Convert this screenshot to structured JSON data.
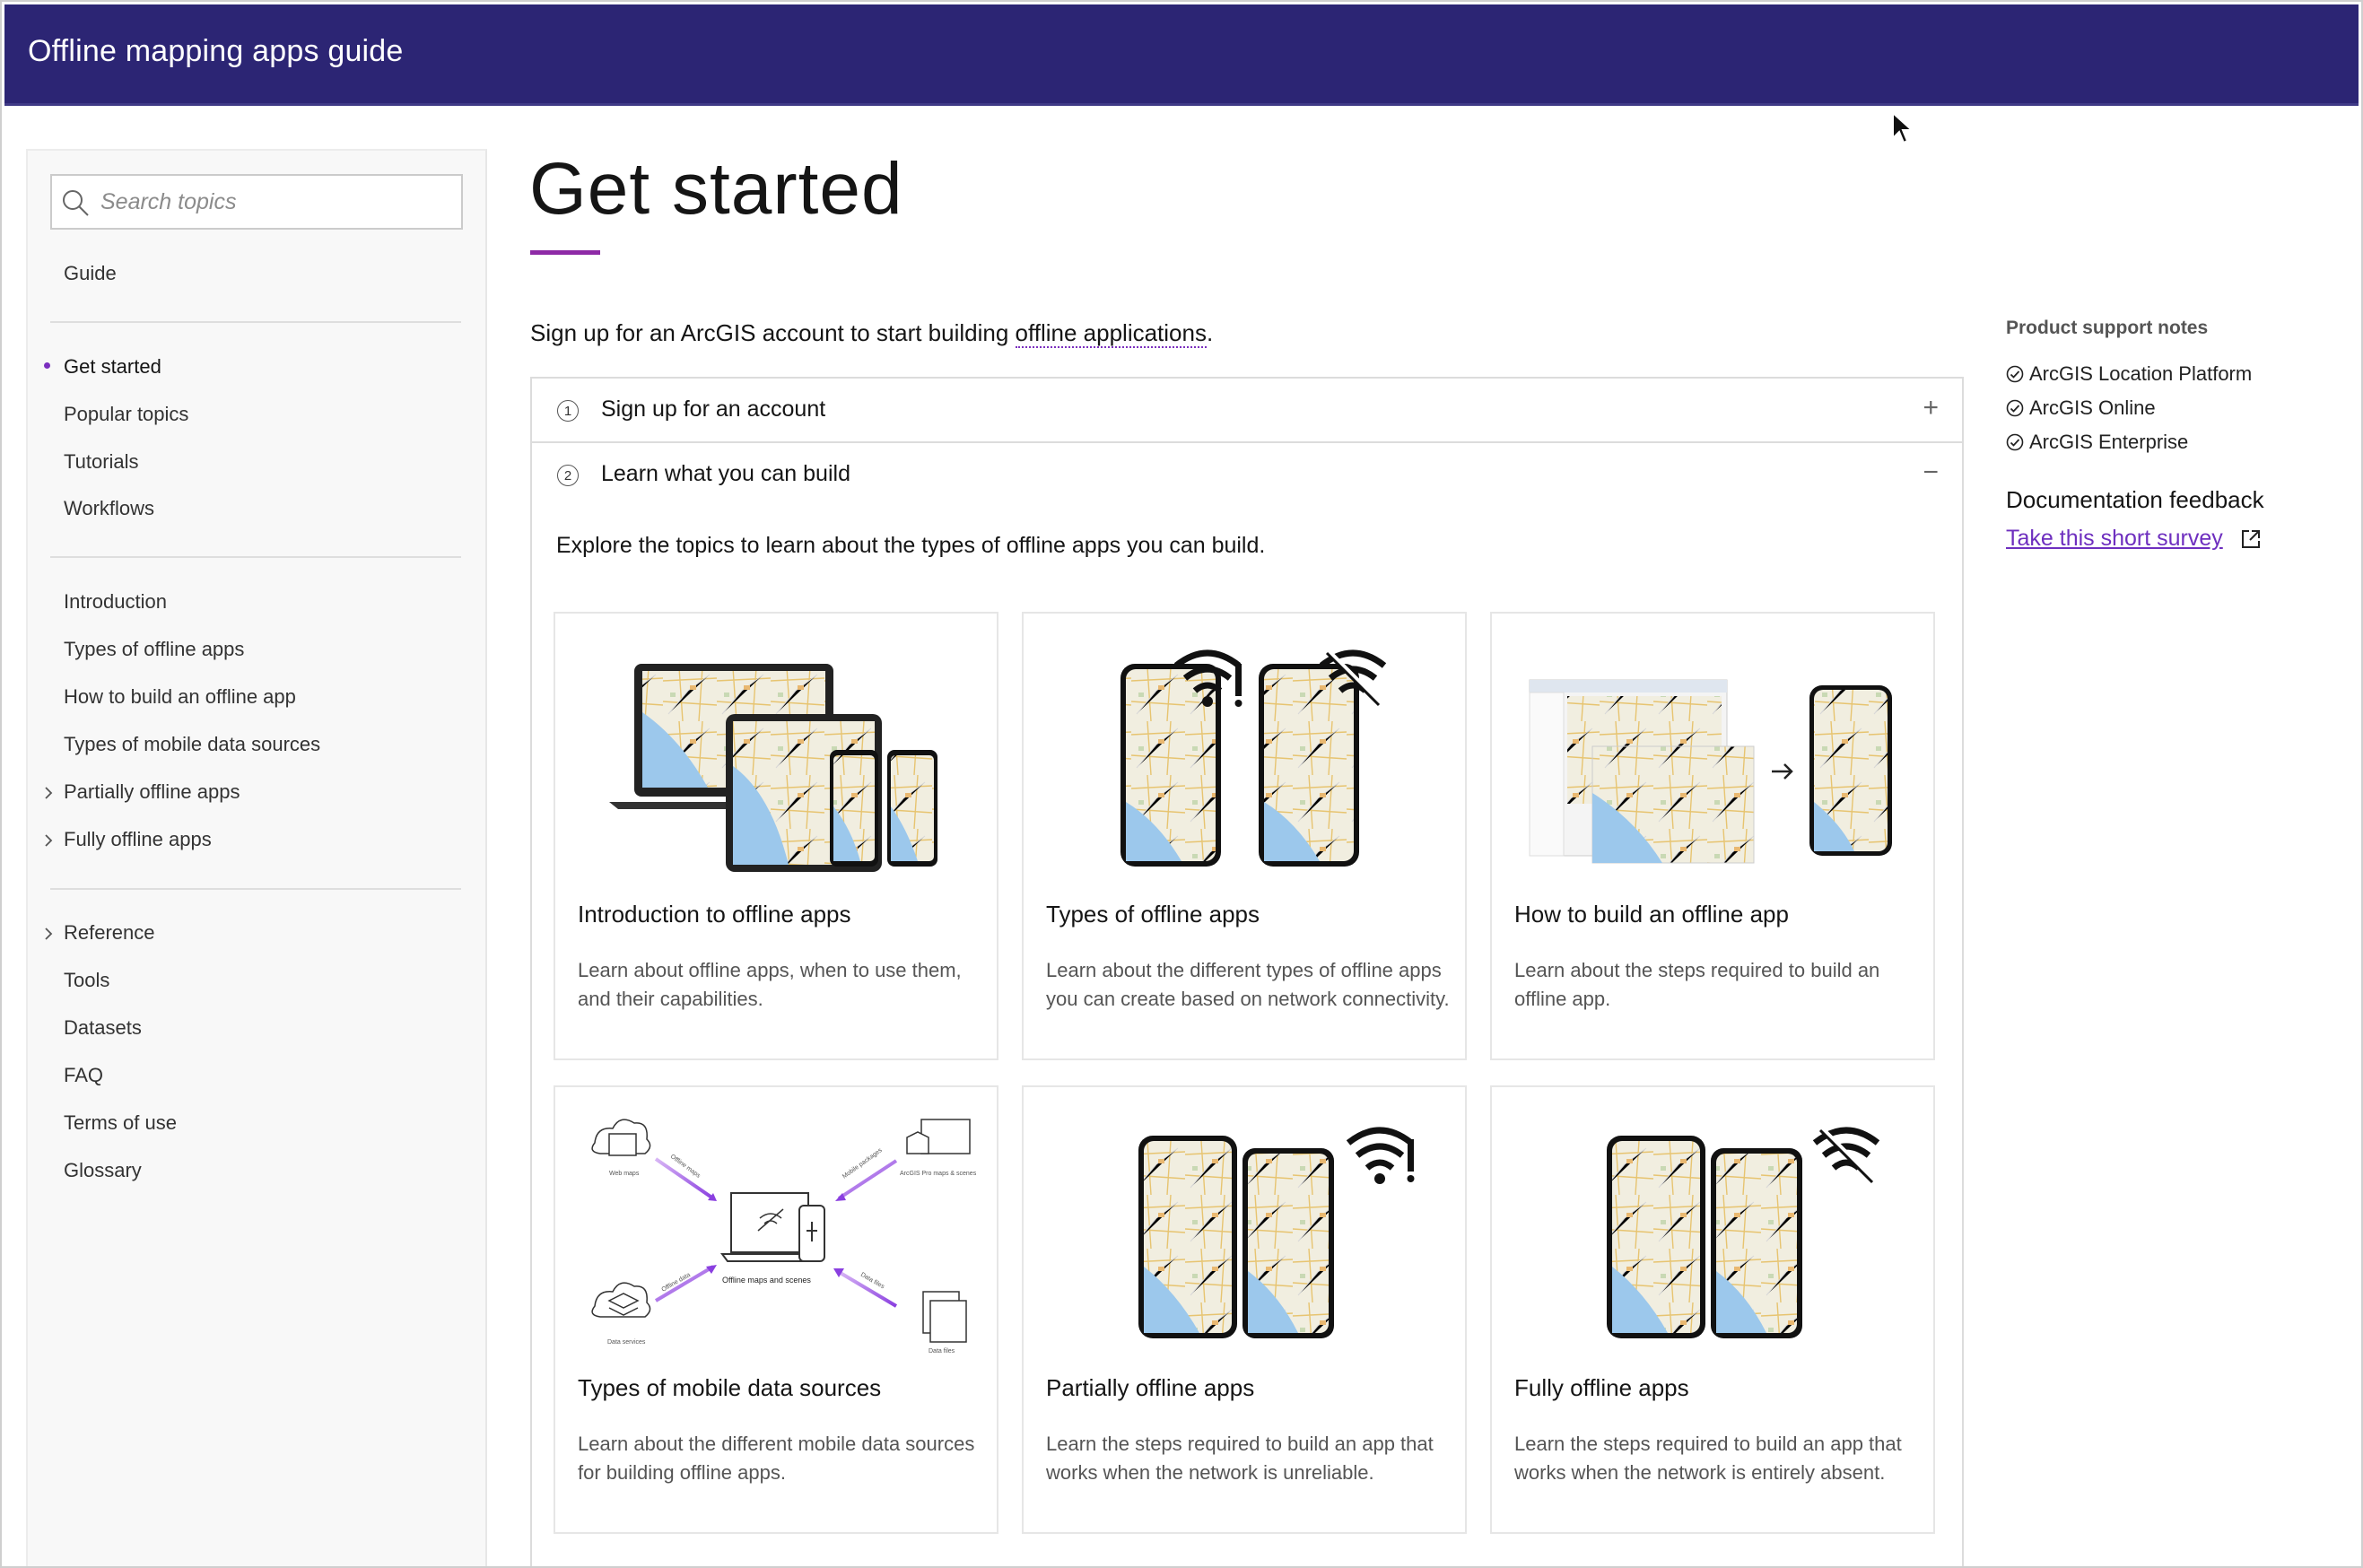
{
  "header": {
    "title": "Offline mapping apps guide"
  },
  "search": {
    "placeholder": "Search topics"
  },
  "sidebar": {
    "top": [
      {
        "label": "Guide"
      }
    ],
    "group1": [
      {
        "label": "Get started",
        "active": true
      },
      {
        "label": "Popular topics"
      },
      {
        "label": "Tutorials"
      },
      {
        "label": "Workflows"
      }
    ],
    "group2": [
      {
        "label": "Introduction"
      },
      {
        "label": "Types of offline apps"
      },
      {
        "label": "How to build an offline app"
      },
      {
        "label": "Types of mobile data sources"
      },
      {
        "label": "Partially offline apps",
        "expandable": true
      },
      {
        "label": "Fully offline apps",
        "expandable": true
      }
    ],
    "group3": [
      {
        "label": "Reference",
        "expandable": true
      },
      {
        "label": "Tools"
      },
      {
        "label": "Datasets"
      },
      {
        "label": "FAQ"
      },
      {
        "label": "Terms of use"
      },
      {
        "label": "Glossary"
      }
    ]
  },
  "main": {
    "title": "Get started",
    "intro_before": "Sign up for an ArcGIS account to start building ",
    "intro_link": "offline applications",
    "intro_after": ".",
    "accordion": [
      {
        "number": "1",
        "title": "Sign up for an account",
        "toggle": "+"
      },
      {
        "number": "2",
        "title": "Learn what you can build",
        "toggle": "−"
      }
    ],
    "explore_text": "Explore the topics to learn about the types of offline apps you can build.",
    "cards": [
      {
        "title": "Introduction to offline apps",
        "description": "Learn about offline apps, when to use them, and their capabilities."
      },
      {
        "title": "Types of offline apps",
        "description": "Learn about the different types of offline apps you can create based on network connectivity."
      },
      {
        "title": "How to build an offline app",
        "description": "Learn about the steps required to build an offline app."
      },
      {
        "title": "Types of mobile data sources",
        "description": "Learn about the different mobile data sources for building offline apps."
      },
      {
        "title": "Partially offline apps",
        "description": "Learn the steps required to build an app that works when the network is unreliable."
      },
      {
        "title": "Fully offline apps",
        "description": "Learn the steps required to build an app that works when the network is entirely absent."
      }
    ],
    "diagram_labels": {
      "center": "Offline maps and scenes",
      "top_left": "Web maps",
      "top_right": "ArcGIS Pro maps & scenes",
      "bottom_left": "Data services",
      "bottom_right": "Data files",
      "arrow_tl": "Offline maps",
      "arrow_tr": "Mobile packages",
      "arrow_bl": "Offline data",
      "arrow_br": "Data files"
    }
  },
  "right_panel": {
    "support_heading": "Product support notes",
    "support_items": [
      "ArcGIS Location Platform",
      "ArcGIS Online",
      "ArcGIS Enterprise"
    ],
    "feedback_heading": "Documentation feedback",
    "survey_link": "Take this short survey"
  },
  "colors": {
    "header_bg": "#2c2574",
    "accent": "#8e2aa6",
    "link": "#6e2fbf"
  }
}
